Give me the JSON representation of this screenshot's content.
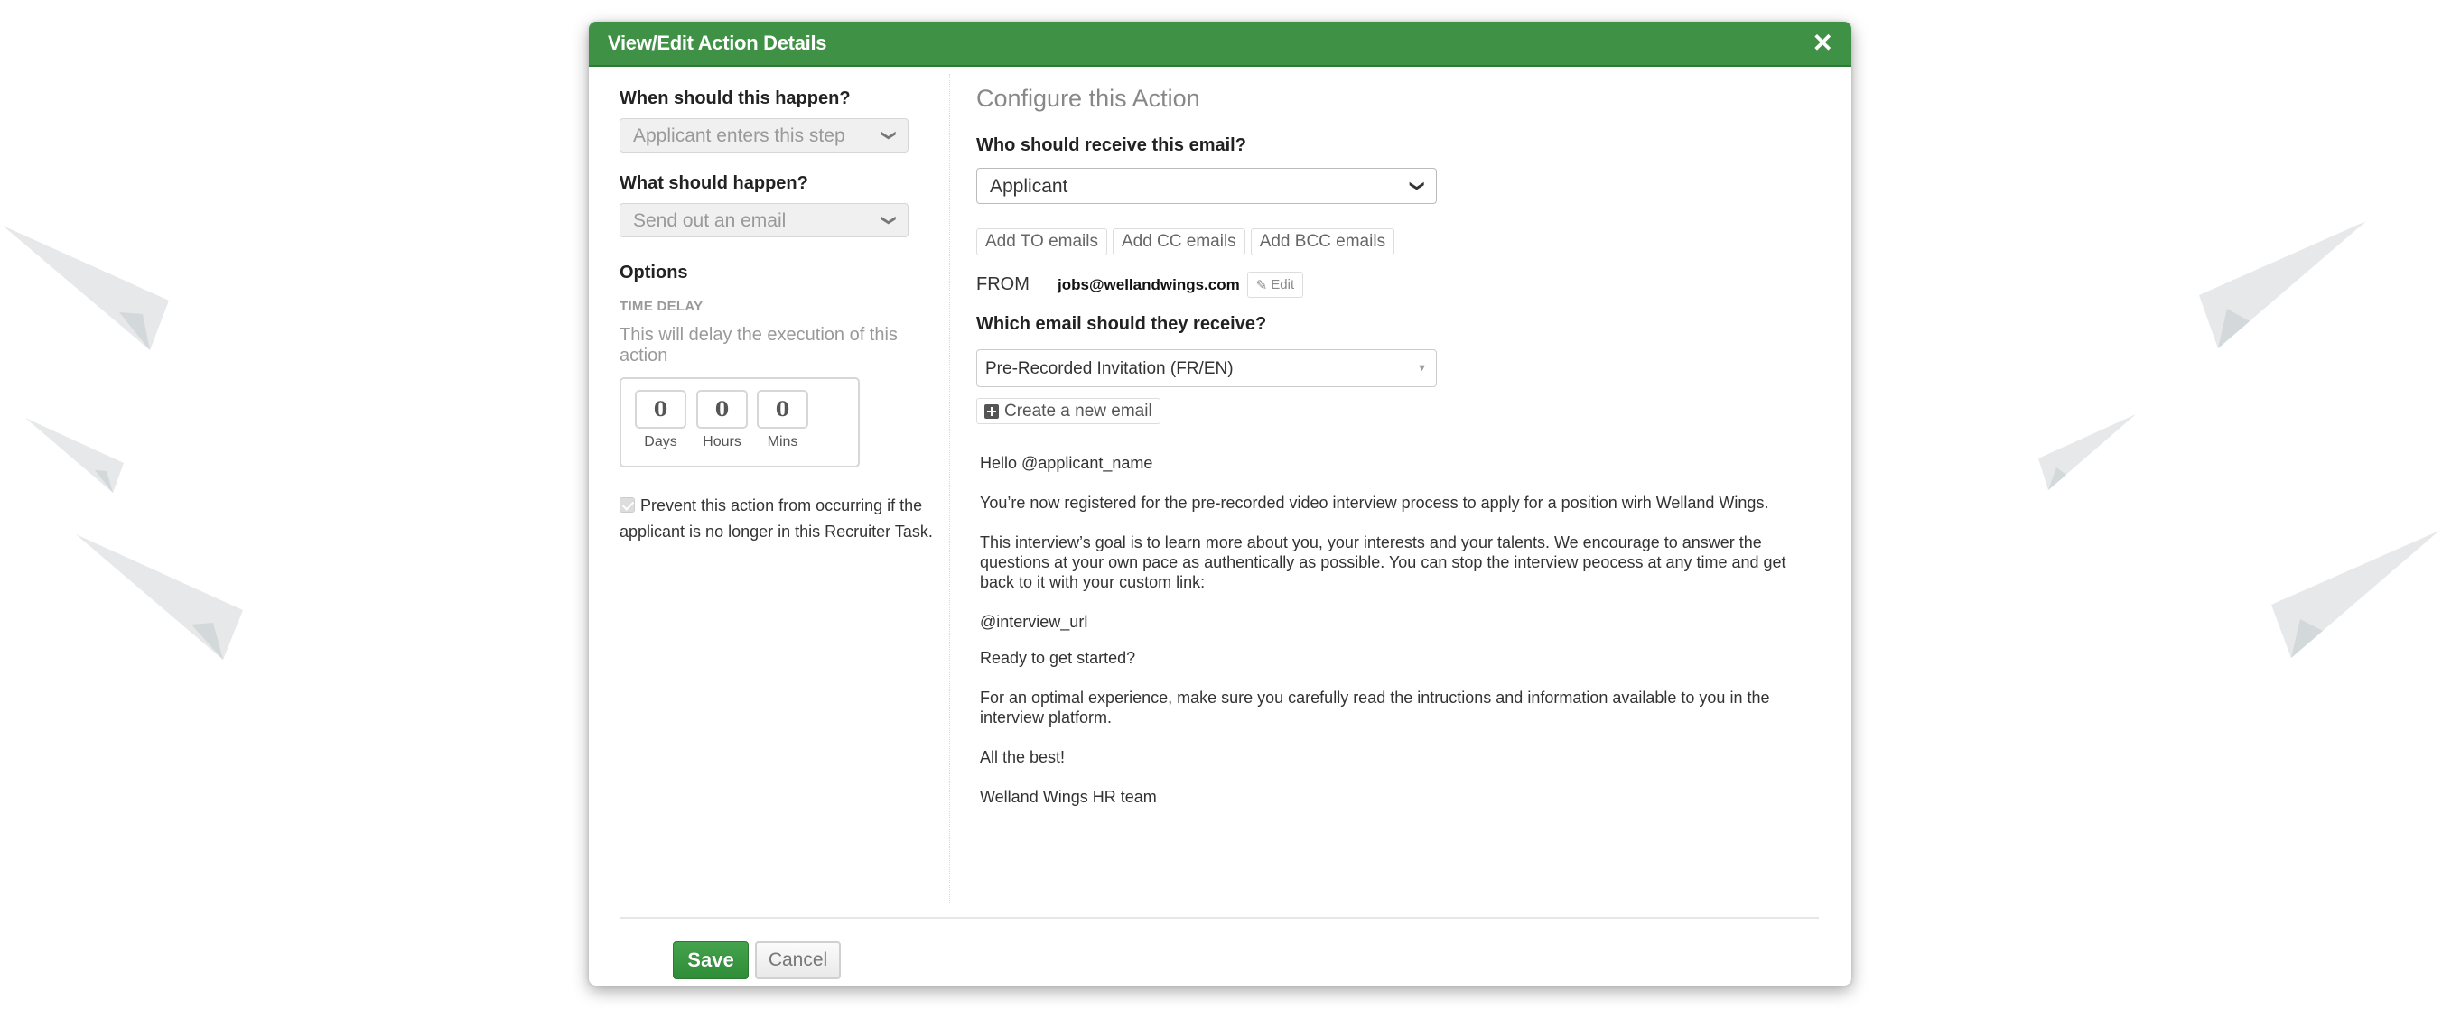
{
  "modal": {
    "title": "View/Edit Action Details",
    "close_icon": "close-icon"
  },
  "left": {
    "when_label": "When should this happen?",
    "when_value": "Applicant enters this step",
    "what_label": "What should happen?",
    "what_value": "Send out an email",
    "options_title": "Options",
    "time_delay_label": "TIME DELAY",
    "time_delay_help": "This will delay the execution of this action",
    "delay": [
      {
        "value": "0",
        "unit": "Days"
      },
      {
        "value": "0",
        "unit": "Hours"
      },
      {
        "value": "0",
        "unit": "Mins"
      }
    ],
    "prevent_checked": true,
    "prevent_text_1": "Prevent this action from occurring if the",
    "prevent_text_2": "applicant is no longer in this Recruiter Task."
  },
  "right": {
    "section_title": "Configure this Action",
    "receive_label": "Who should receive this email?",
    "recipient_value": "Applicant",
    "add_buttons": [
      "Add TO emails",
      "Add CC emails",
      "Add BCC emails"
    ],
    "from_label": "FROM",
    "from_email": "jobs@wellandwings.com",
    "edit_label": "Edit",
    "which_email_label": "Which email should they receive?",
    "email_template_value": "Pre-Recorded Invitation (FR/EN)",
    "create_email_label": "Create a new email",
    "email_body": [
      "Hello @applicant_name",
      "You’re now registered for the pre-recorded video interview process to apply for a position wirh Welland Wings.",
      "This interview’s goal is to learn more about you, your interests and your talents. We encourage to answer the questions at your own pace as authentically as possible. You can stop the interview peocess at any time and get back to it with your custom link:",
      "@interview_url",
      "Ready to get started?",
      "For an optimal experience, make sure you carefully read the intructions and information available to you in the interview platform.",
      "All the best!",
      "Welland Wings HR team"
    ]
  },
  "footer": {
    "save_label": "Save",
    "cancel_label": "Cancel"
  },
  "colors": {
    "header_green": "#3e9145",
    "save_green": "#3a9a43",
    "background_plane": "#e6e8ea",
    "background_plane_shadow": "#d3d8db"
  }
}
